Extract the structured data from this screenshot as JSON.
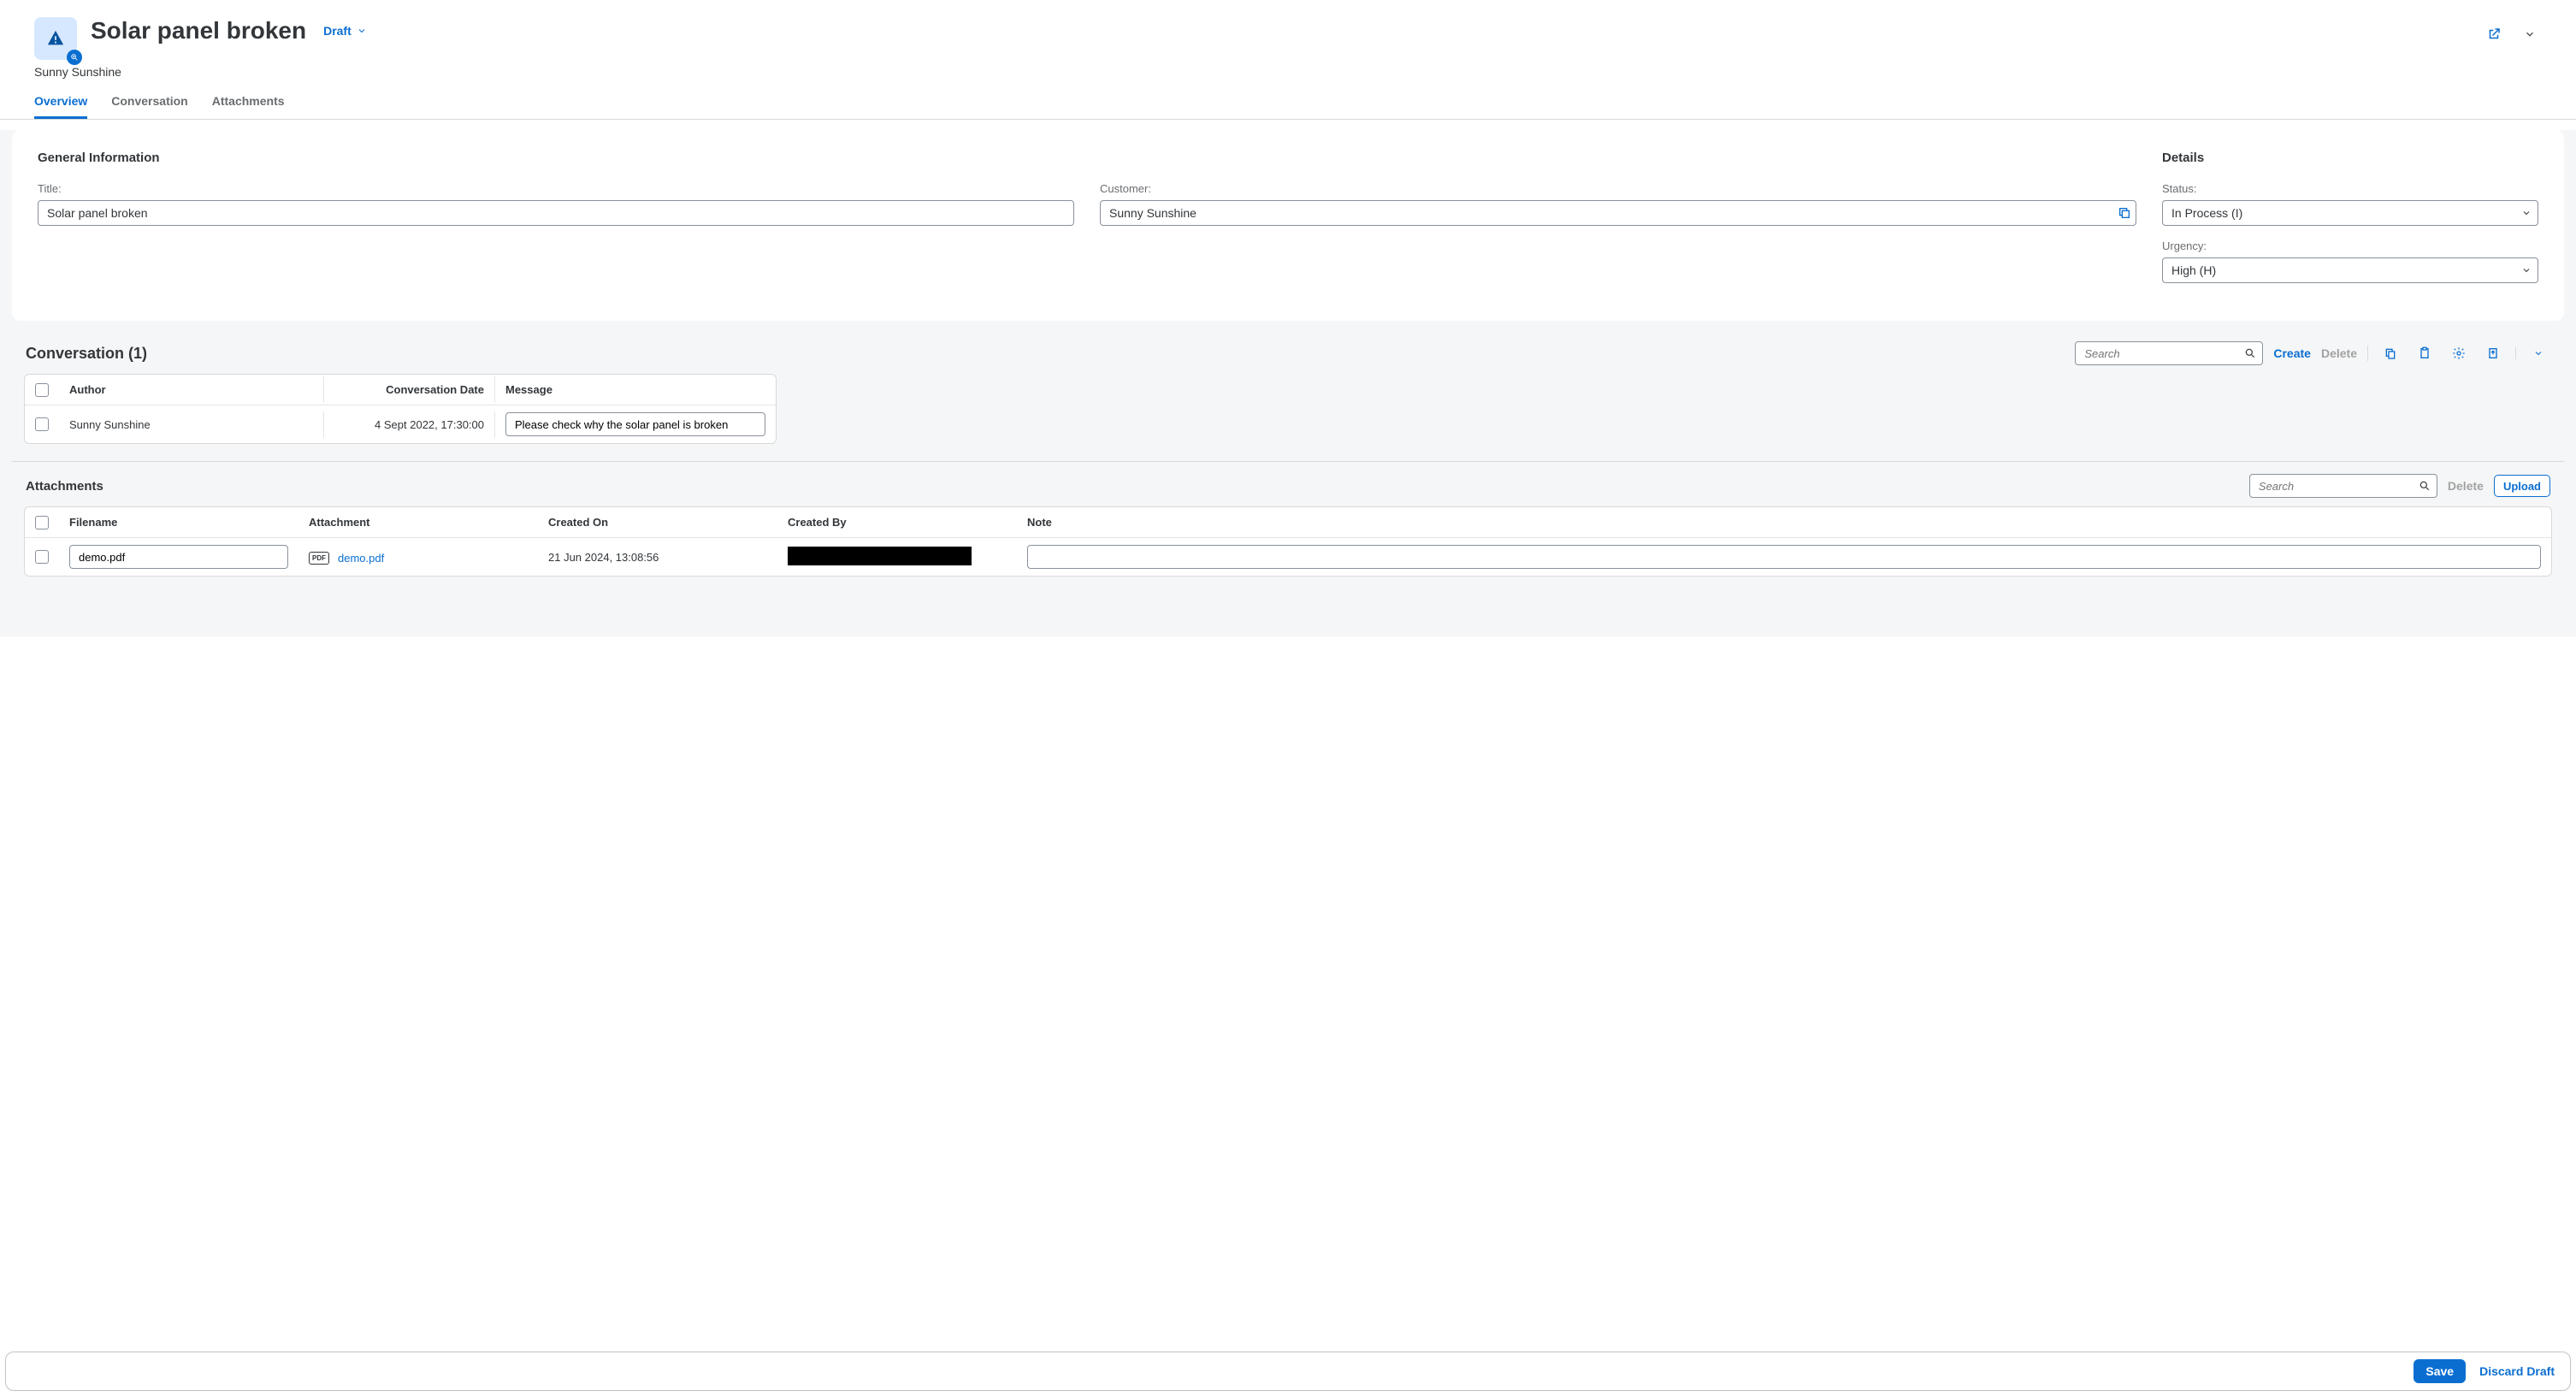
{
  "header": {
    "title": "Solar panel broken",
    "statusLabel": "Draft",
    "subtitle": "Sunny Sunshine"
  },
  "tabs": [
    {
      "label": "Overview",
      "active": true
    },
    {
      "label": "Conversation",
      "active": false
    },
    {
      "label": "Attachments",
      "active": false
    }
  ],
  "general": {
    "sectionTitle": "General Information",
    "titleLabel": "Title:",
    "titleValue": "Solar panel broken",
    "customerLabel": "Customer:",
    "customerValue": "Sunny Sunshine"
  },
  "details": {
    "sectionTitle": "Details",
    "statusLabel": "Status:",
    "statusValue": "In Process (I)",
    "urgencyLabel": "Urgency:",
    "urgencyValue": "High (H)"
  },
  "conversation": {
    "title": "Conversation (1)",
    "searchPlaceholder": "Search",
    "createLabel": "Create",
    "deleteLabel": "Delete",
    "columns": {
      "author": "Author",
      "date": "Conversation Date",
      "message": "Message"
    },
    "rows": [
      {
        "author": "Sunny Sunshine",
        "date": "4 Sept 2022, 17:30:00",
        "message": "Please check why the solar panel is broken"
      }
    ]
  },
  "attachments": {
    "title": "Attachments",
    "searchPlaceholder": "Search",
    "deleteLabel": "Delete",
    "uploadLabel": "Upload",
    "columns": {
      "filename": "Filename",
      "attachment": "Attachment",
      "createdOn": "Created On",
      "createdBy": "Created By",
      "note": "Note"
    },
    "rows": [
      {
        "filename": "demo.pdf",
        "linkText": "demo.pdf",
        "createdOn": "21 Jun 2024, 13:08:56",
        "createdBy": "",
        "note": ""
      }
    ]
  },
  "footer": {
    "save": "Save",
    "discard": "Discard Draft"
  }
}
